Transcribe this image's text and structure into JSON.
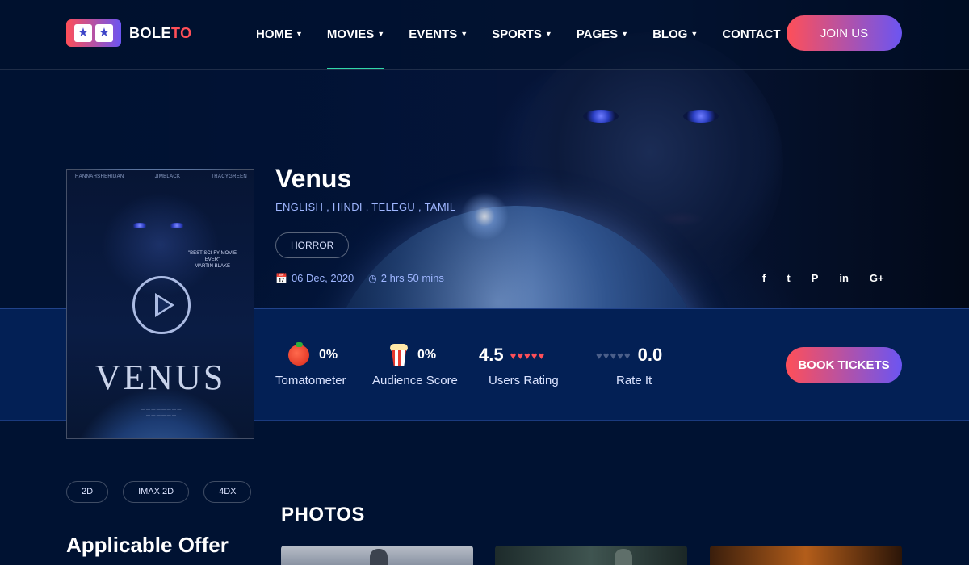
{
  "brand": {
    "name_main": "BOLE",
    "name_accent": "TO",
    "logo_icon": "ticket-stars-icon"
  },
  "nav": {
    "items": [
      {
        "label": "HOME",
        "has_dropdown": true
      },
      {
        "label": "MOVIES",
        "has_dropdown": true,
        "active": true
      },
      {
        "label": "EVENTS",
        "has_dropdown": true
      },
      {
        "label": "SPORTS",
        "has_dropdown": true
      },
      {
        "label": "PAGES",
        "has_dropdown": true
      },
      {
        "label": "BLOG",
        "has_dropdown": true
      },
      {
        "label": "CONTACT",
        "has_dropdown": false
      }
    ],
    "join_label": "JOIN US"
  },
  "movie": {
    "title": "Venus",
    "languages": "ENGLISH , HINDI , TELEGU , TAMIL",
    "genre": "HORROR",
    "release_date": "06 Dec, 2020",
    "duration": "2 hrs 50 mins",
    "poster": {
      "title": "VENUS",
      "cast": [
        "HANNAHSHERIDAN",
        "JIMBLACK",
        "TRACYGREEN"
      ],
      "tagline": "\"BEST SCI-FY MOVIE EVER\"",
      "tagline_source": "MARTIN BLAKE"
    }
  },
  "social": [
    {
      "icon": "facebook-icon",
      "glyph": "f"
    },
    {
      "icon": "twitter-icon",
      "glyph": "t"
    },
    {
      "icon": "pinterest-icon",
      "glyph": "P"
    },
    {
      "icon": "linkedin-icon",
      "glyph": "in"
    },
    {
      "icon": "google-plus-icon",
      "glyph": "G+"
    }
  ],
  "ratings": {
    "tomatometer": {
      "value": "0%",
      "label": "Tomatometer"
    },
    "audience": {
      "value": "0%",
      "label": "Audience Score"
    },
    "users": {
      "value": "4.5",
      "label": "Users Rating",
      "hearts_filled": 5
    },
    "rate_it": {
      "value": "0.0",
      "label": "Rate It",
      "hearts_filled": 0
    },
    "book_label": "BOOK TICKETS"
  },
  "formats": [
    "2D",
    "IMAX 2D",
    "4DX"
  ],
  "sections": {
    "offer_title": "Applicable Offer",
    "photos_title": "PHOTOS"
  },
  "colors": {
    "background": "#001232",
    "accent_start": "#ff4f58",
    "accent_end": "#6b55f2",
    "active_underline": "#31d7a9",
    "rating_bar": "#032055"
  }
}
